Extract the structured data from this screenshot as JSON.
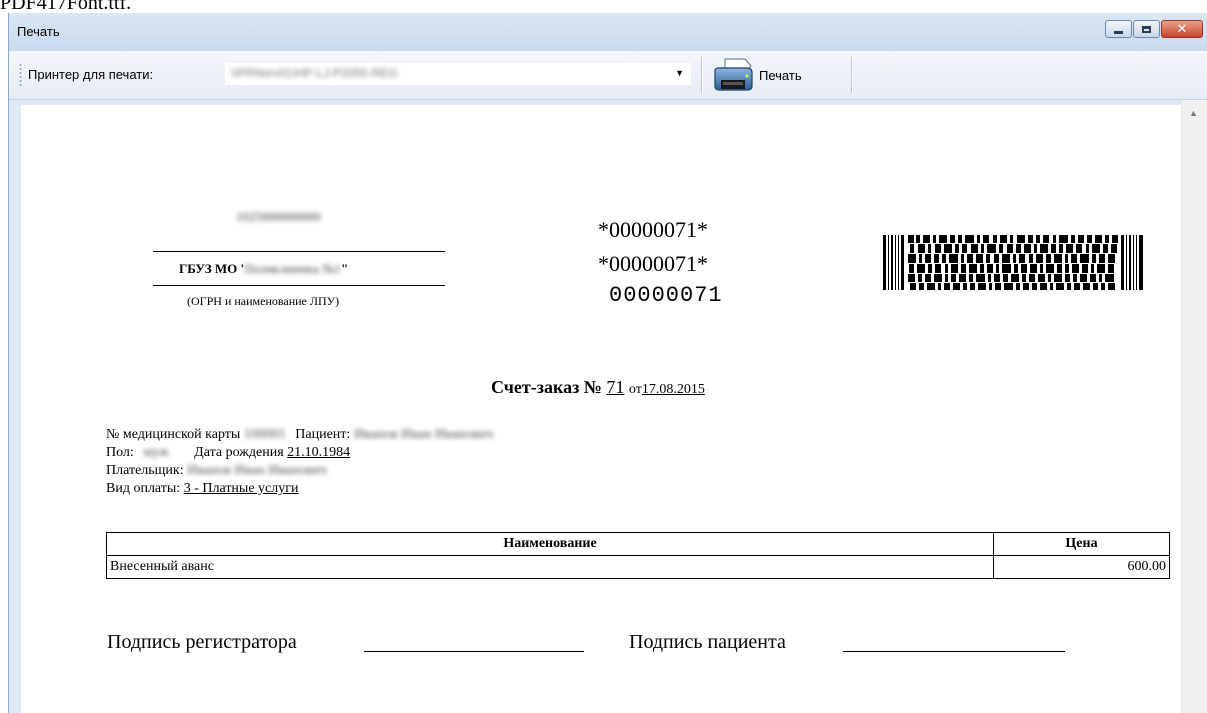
{
  "window": {
    "title": "Печать",
    "buttons": {
      "minimize": "minimize",
      "maximize": "maximize",
      "close": "✕"
    }
  },
  "toolbar": {
    "printer_label": "Принтер для печати:",
    "printer_value": "\\\\PRNsrv01\\HP-LJ-P2055-REG",
    "print_button": "Печать"
  },
  "document": {
    "ogrn": "1025000000000",
    "org_prefix": "ГБУЗ МО '",
    "org_name": "Поликлиника №1",
    "org_suffix": "\"",
    "ogrn_caption": "(ОГРН и наименование ЛПУ)",
    "code_line1": "*00000071*",
    "code_line2": "*00000071*",
    "code_line3": "00000071",
    "invoice_title": "Счет-заказ №",
    "invoice_number": "71",
    "invoice_from": "от",
    "invoice_date": "17.08.2015",
    "card_label": "№ медицинской карты",
    "card_value": "100001",
    "patient_label": "Пациент:",
    "patient_value": "Иванов Иван Иванович",
    "sex_label": "Пол:",
    "sex_value": "муж",
    "dob_label": "Дата рождения",
    "dob_value": "21.10.1984",
    "payer_label": "Плательщик:",
    "payer_value": "Иванов Иван Иванович",
    "payment_label": "Вид оплаты:",
    "payment_value": "3 - Платные услуги",
    "table": {
      "headers": [
        "Наименование",
        "Цена"
      ],
      "rows": [
        [
          "Внесенный аванс",
          "600.00"
        ]
      ]
    },
    "sig_registrar": "Подпись регистратора",
    "sig_patient": "Подпись пациента"
  },
  "colors": {
    "window_frame": "#dfe9f5",
    "close_button": "#c7462c",
    "paper": "#ffffff"
  }
}
